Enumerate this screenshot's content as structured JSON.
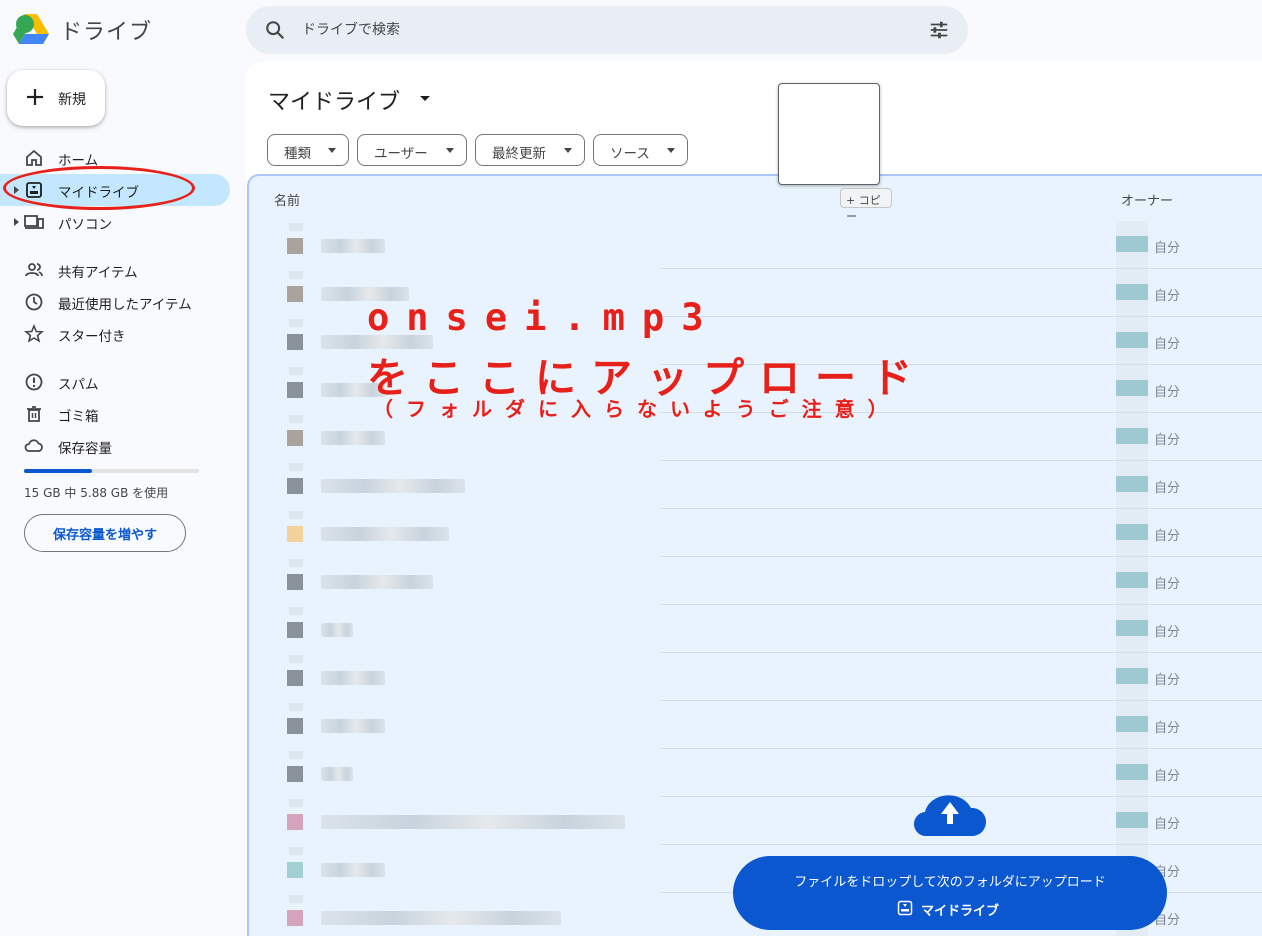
{
  "app": {
    "title": "ドライブ"
  },
  "search": {
    "placeholder": "ドライブで検索"
  },
  "sidebar": {
    "new_label": "新規",
    "items": [
      {
        "label": "ホーム"
      },
      {
        "label": "マイドライブ"
      },
      {
        "label": "パソコン"
      },
      {
        "label": "共有アイテム"
      },
      {
        "label": "最近使用したアイテム"
      },
      {
        "label": "スター付き"
      },
      {
        "label": "スパム"
      },
      {
        "label": "ゴミ箱"
      },
      {
        "label": "保存容量"
      }
    ],
    "storage_text": "15 GB 中 5.88 GB を使用",
    "storage_fraction": 0.39,
    "more_storage_label": "保存容量を増やす"
  },
  "main": {
    "title": "マイドライブ",
    "chips": [
      "種類",
      "ユーザー",
      "最終更新",
      "ソース"
    ],
    "columns": {
      "name": "名前",
      "owner": "オーナー"
    },
    "copy_badge": "+ コピー",
    "owner_label": "自分"
  },
  "annotation": {
    "line1": "onsei.mp3",
    "line2": "をここにアップロード",
    "line3": "（フォルダに入らないようご注意）"
  },
  "upload": {
    "line1": "ファイルをドロップして次のフォルダにアップロード",
    "target": "マイドライブ"
  },
  "colors": {
    "accent": "#0b57d0",
    "active_nav": "#c2e7ff",
    "annotation": "#e8201a"
  }
}
